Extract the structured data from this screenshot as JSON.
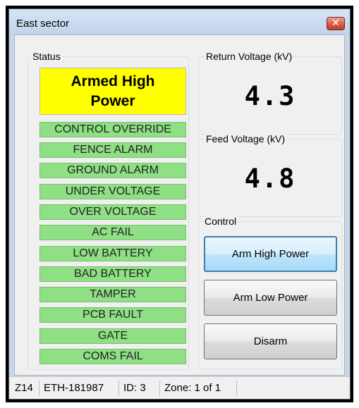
{
  "window": {
    "title": "East sector"
  },
  "status": {
    "group_label": "Status",
    "banner": "Armed High Power",
    "items": [
      "CONTROL OVERRIDE",
      "FENCE ALARM",
      "GROUND ALARM",
      "UNDER VOLTAGE",
      "OVER VOLTAGE",
      "AC FAIL",
      "LOW BATTERY",
      "BAD BATTERY",
      "TAMPER",
      "PCB FAULT",
      "GATE",
      "COMS FAIL"
    ]
  },
  "return_voltage": {
    "label": "Return Voltage (kV)",
    "value": "4.3"
  },
  "feed_voltage": {
    "label": "Feed Voltage (kV)",
    "value": "4.8"
  },
  "control": {
    "label": "Control",
    "arm_high": "Arm High Power",
    "arm_low": "Arm Low Power",
    "disarm": "Disarm"
  },
  "statusbar": {
    "node": "Z14",
    "device": "ETH-181987",
    "id": "ID: 3",
    "zone": "Zone: 1 of 1"
  },
  "colors": {
    "armed_banner": "#ffff00",
    "status_item_normal": "#8fdf85",
    "default_button": "#3c7fb1"
  }
}
